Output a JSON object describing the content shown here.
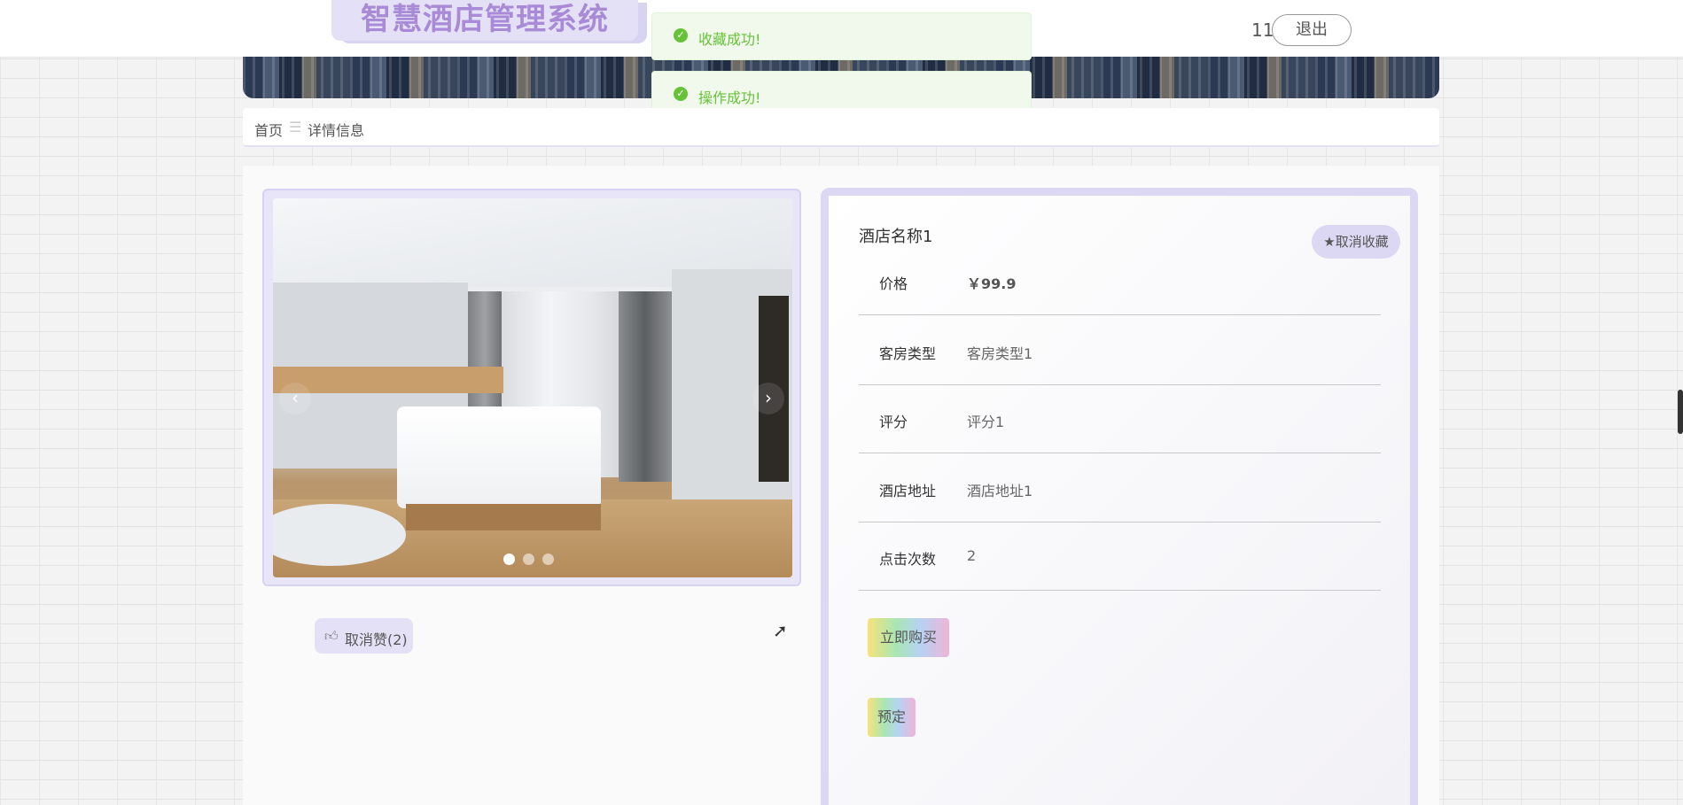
{
  "header": {
    "system_title": "智慧酒店管理系统",
    "username": "11",
    "logout_label": "退出"
  },
  "toasts": [
    {
      "message": "收藏成功!"
    },
    {
      "message": "操作成功!"
    }
  ],
  "breadcrumb": {
    "home": "首页",
    "separator": "☰",
    "current": "详情信息"
  },
  "gallery": {
    "prev_label": "‹",
    "next_label": "›",
    "slide_count": 3,
    "active_slide": 1
  },
  "like": {
    "label": "取消赞(2)"
  },
  "detail": {
    "hotel_name": "酒店名称1",
    "favorite_label": "★取消收藏",
    "fields": [
      {
        "label": "价格",
        "value": "￥99.9"
      },
      {
        "label": "客房类型",
        "value": "客房类型1"
      },
      {
        "label": "评分",
        "value": "评分1"
      },
      {
        "label": "酒店地址",
        "value": "酒店地址1"
      },
      {
        "label": "点击次数",
        "value": "2"
      }
    ],
    "buy_label": "立即购买",
    "book_label": "预定"
  },
  "colors": {
    "accent": "#e4e1f6",
    "accent_border": "#d6d2f2",
    "logo_text": "#a88ad6",
    "success": "#67c23a"
  }
}
